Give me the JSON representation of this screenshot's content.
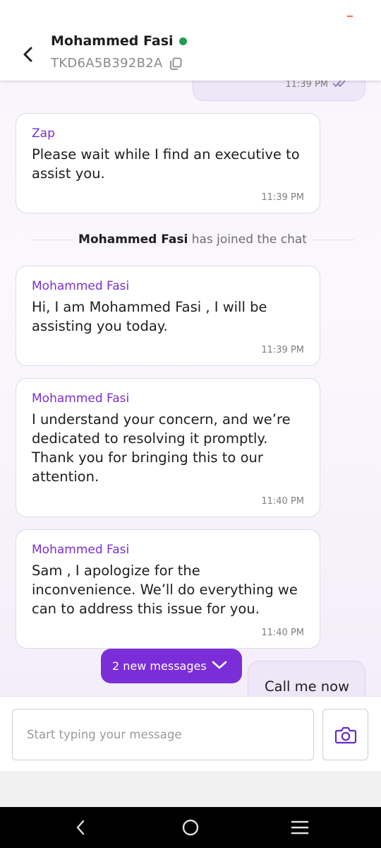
{
  "header": {
    "agent_name": "Mohammed Fasi",
    "ticket_id": "TKD6A5B392B2A"
  },
  "messages": [
    {
      "time": "11:39 PM"
    },
    {
      "sender": "Zap",
      "text": "Please wait while I find an executive to assist you.",
      "time": "11:39 PM"
    },
    {
      "sender": "Mohammed Fasi",
      "text": "Hi, I am Mohammed Fasi , I will be assisting you today.",
      "time": "11:39 PM"
    },
    {
      "sender": "Mohammed Fasi",
      "text": "I understand your concern, and we’re dedicated to resolving it promptly. Thank you for bringing this to our attention.",
      "time": "11:40 PM"
    },
    {
      "sender": "Mohammed Fasi",
      "text": "Sam , I apologize for the inconvenience. We’ll do everything we can to address this issue for you.",
      "time": "11:40 PM"
    },
    {
      "text": "Call me now"
    }
  ],
  "system_event": {
    "name": "Mohammed Fasi",
    "suffix": "has joined the chat"
  },
  "new_messages_label": "2 new messages",
  "composer": {
    "placeholder": "Start typing your message"
  },
  "colors": {
    "accent": "#7b2ed8",
    "online": "#1e9e4c",
    "sender": "#7a2fd0",
    "user_bubble": "#eee7f8"
  },
  "icons": [
    "back-arrow-icon",
    "copy-icon",
    "double-check-icon",
    "chevron-down-icon",
    "camera-icon",
    "nav-back-icon",
    "nav-home-icon",
    "nav-menu-icon"
  ]
}
